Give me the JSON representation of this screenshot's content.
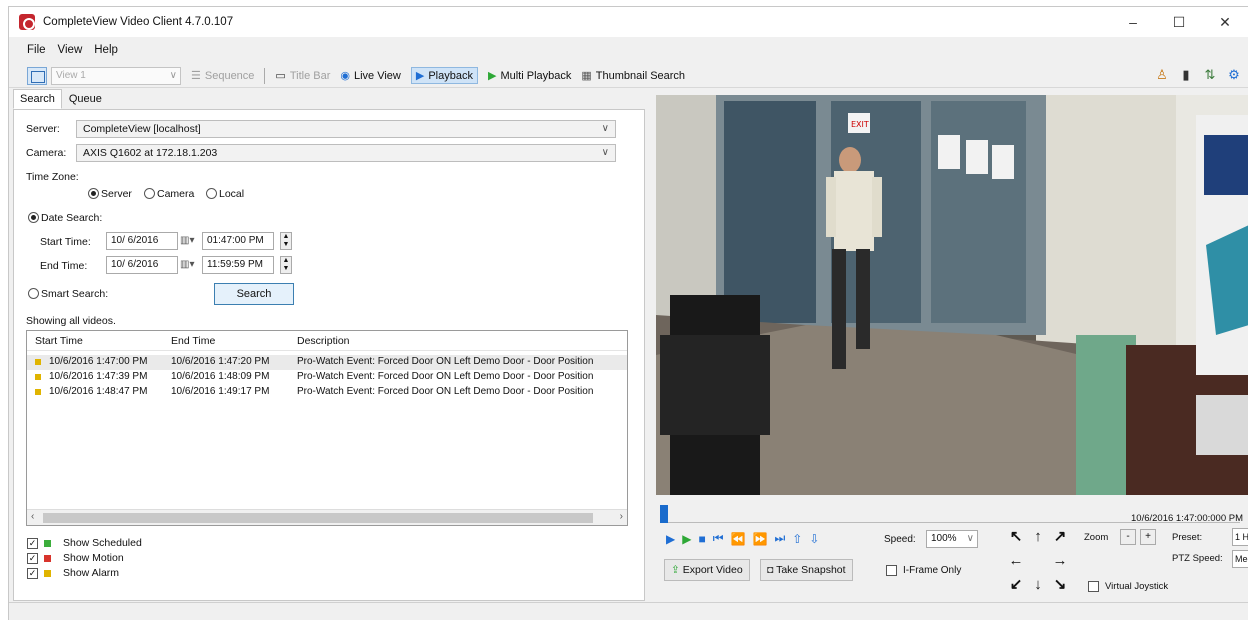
{
  "window": {
    "title": "CompleteView Video Client 4.7.0.107",
    "controls": [
      "–",
      "☐",
      "✕"
    ]
  },
  "menu": [
    "File",
    "View",
    "Help"
  ],
  "toolbar": {
    "view_select": "View 1",
    "sequence": "Sequence",
    "title_bar": "Title Bar",
    "live_view": "Live View",
    "playback": "Playback",
    "multi_playback": "Multi Playback",
    "thumbnail_search": "Thumbnail Search"
  },
  "tabs": [
    "Search",
    "Queue"
  ],
  "search": {
    "server_label": "Server:",
    "server_value": "CompleteView [localhost]",
    "camera_label": "Camera:",
    "camera_value": "AXIS Q1602 at 172.18.1.203",
    "timezone_label": "Time Zone:",
    "tz_server": "Server",
    "tz_camera": "Camera",
    "tz_local": "Local",
    "date_search": "Date Search:",
    "start_label": "Start Time:",
    "start_date": "10/ 6/2016",
    "start_time": "01:47:00 PM",
    "end_label": "End Time:",
    "end_date": "10/ 6/2016",
    "end_time": "11:59:59 PM",
    "smart_search": "Smart Search:",
    "search_button": "Search",
    "showing": "Showing all videos."
  },
  "results": {
    "columns": [
      "Start Time",
      "End Time",
      "Description"
    ],
    "rows": [
      {
        "start": "10/6/2016 1:47:00 PM",
        "end": "10/6/2016 1:47:20 PM",
        "desc": "Pro-Watch Event: Forced Door ON Left Demo Door - Door Position"
      },
      {
        "start": "10/6/2016 1:47:39 PM",
        "end": "10/6/2016 1:48:09 PM",
        "desc": "Pro-Watch Event: Forced Door ON Left Demo Door - Door Position"
      },
      {
        "start": "10/6/2016 1:48:47 PM",
        "end": "10/6/2016 1:49:17 PM",
        "desc": "Pro-Watch Event: Forced Door ON Left Demo Door - Door Position"
      }
    ]
  },
  "legend": [
    {
      "label": "Show Scheduled",
      "color": "#3cae3c"
    },
    {
      "label": "Show Motion",
      "color": "#d8342c"
    },
    {
      "label": "Show Alarm",
      "color": "#e0b400"
    }
  ],
  "player": {
    "timestamp": "10/6/2016 1:47:00:000 PM",
    "speed_label": "Speed:",
    "speed_value": "100%",
    "export_video": "Export Video",
    "take_snapshot": "Take Snapshot",
    "iframe_only": "I-Frame Only",
    "zoom_label": "Zoom",
    "zoom_minus": "-",
    "zoom_plus": "+",
    "preset_label": "Preset:",
    "preset_value": "1 H",
    "ptz_speed_label": "PTZ Speed:",
    "ptz_speed_value": "Med",
    "virtual_joystick": "Virtual Joystick",
    "exit_sign": "EXIT"
  },
  "colors": {
    "accent": "#1f6ed4",
    "app_icon": "#c4262e"
  }
}
